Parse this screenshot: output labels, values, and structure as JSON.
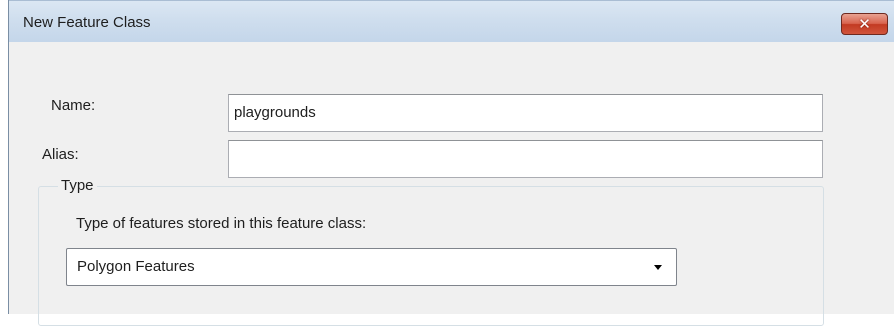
{
  "window": {
    "title": "New Feature Class",
    "close_symbol": "✕"
  },
  "form": {
    "name_label": "Name:",
    "name_value": "playgrounds",
    "alias_label": "Alias:",
    "alias_value": ""
  },
  "type_group": {
    "title": "Type",
    "description": "Type of features stored in this feature class:",
    "selected_option": "Polygon Features"
  },
  "icons": {
    "close": "close-icon",
    "dropdown": "chevron-down-icon"
  }
}
